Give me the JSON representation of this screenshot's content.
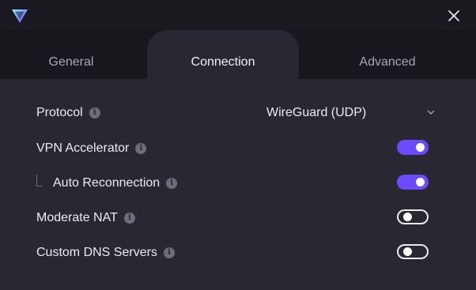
{
  "window": {
    "logo_icon": "proton-vpn-logo-icon",
    "close_icon": "close-icon"
  },
  "tabs": [
    {
      "label": "General",
      "active": false
    },
    {
      "label": "Connection",
      "active": true
    },
    {
      "label": "Advanced",
      "active": false
    }
  ],
  "settings": {
    "protocol": {
      "label": "Protocol",
      "value": "WireGuard (UDP)"
    },
    "vpn_accelerator": {
      "label": "VPN Accelerator",
      "enabled": true
    },
    "auto_reconnection": {
      "label": "Auto Reconnection",
      "enabled": true
    },
    "moderate_nat": {
      "label": "Moderate NAT",
      "enabled": false
    },
    "custom_dns": {
      "label": "Custom DNS Servers",
      "enabled": false
    }
  },
  "colors": {
    "accent": "#6d4aff",
    "background": "#292832",
    "tab_bar": "#18171d"
  }
}
